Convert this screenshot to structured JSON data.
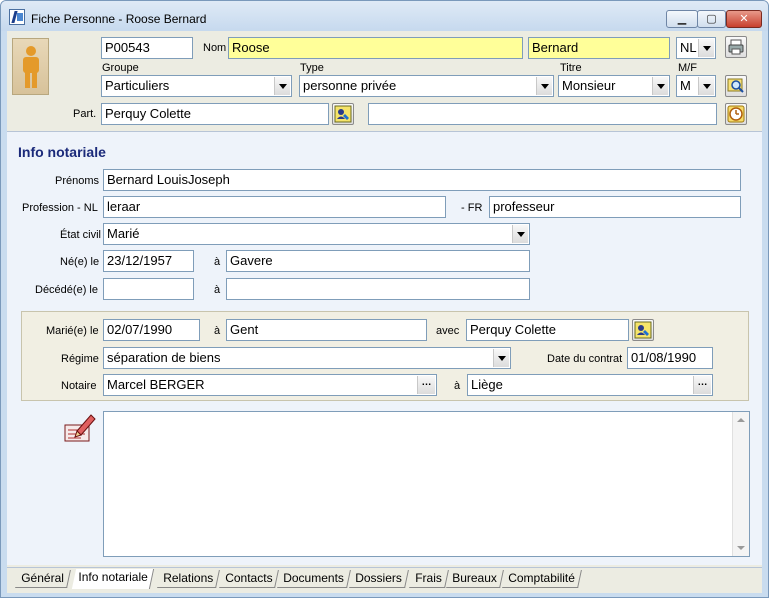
{
  "window": {
    "title": "Fiche Personne - Roose Bernard",
    "controls": {
      "minimize": "▁",
      "maximize": "▢",
      "close": "✕"
    }
  },
  "header": {
    "code": "P00543",
    "nom_label": "Nom",
    "nom_value": "Roose",
    "prenom_value": "Bernard",
    "lang_value": "NL",
    "groupe_label": "Groupe",
    "groupe_value": "Particuliers",
    "type_label": "Type",
    "type_value": "personne privée",
    "titre_label": "Titre",
    "titre_value": "Monsieur",
    "mf_label": "M/F",
    "mf_value": "M",
    "part_label": "Part.",
    "part_value": "Perquy Colette",
    "part_extra_value": ""
  },
  "info": {
    "section_title": "Info notariale",
    "prenoms_label": "Prénoms",
    "prenoms_value": "Bernard LouisJoseph",
    "profession_nl_label": "Profession - NL",
    "profession_nl_value": "leraar",
    "profession_fr_label": "- FR",
    "profession_fr_value": "professeur",
    "etat_civil_label": "État civil",
    "etat_civil_value": "Marié",
    "ne_le_label": "Né(e) le",
    "ne_le_value": "23/12/1957",
    "ne_a_label": "à",
    "ne_a_value": "Gavere",
    "decede_label": "Décédé(e) le",
    "decede_value": "",
    "decede_a_label": "à",
    "decede_a_value": ""
  },
  "marriage": {
    "marie_label": "Marié(e) le",
    "marie_value": "02/07/1990",
    "marie_a_label": "à",
    "marie_a_value": "Gent",
    "avec_label": "avec",
    "avec_value": "Perquy Colette",
    "regime_label": "Régime",
    "regime_value": "séparation de biens",
    "date_contrat_label": "Date du contrat",
    "date_contrat_value": "01/08/1990",
    "notaire_label": "Notaire",
    "notaire_value": "Marcel BERGER",
    "notaire_a_label": "à",
    "notaire_a_value": "Liège"
  },
  "notes": {
    "value": ""
  },
  "tabs": [
    {
      "label": "Général"
    },
    {
      "label": "Info notariale"
    },
    {
      "label": "Relations"
    },
    {
      "label": "Contacts"
    },
    {
      "label": "Documents"
    },
    {
      "label": "Dossiers"
    },
    {
      "label": "Frais"
    },
    {
      "label": "Bureaux"
    },
    {
      "label": "Comptabilité"
    }
  ],
  "colors": {
    "highlight": "#ffff99",
    "section_title": "#1b2a7a",
    "accent": "#7f9db9"
  }
}
